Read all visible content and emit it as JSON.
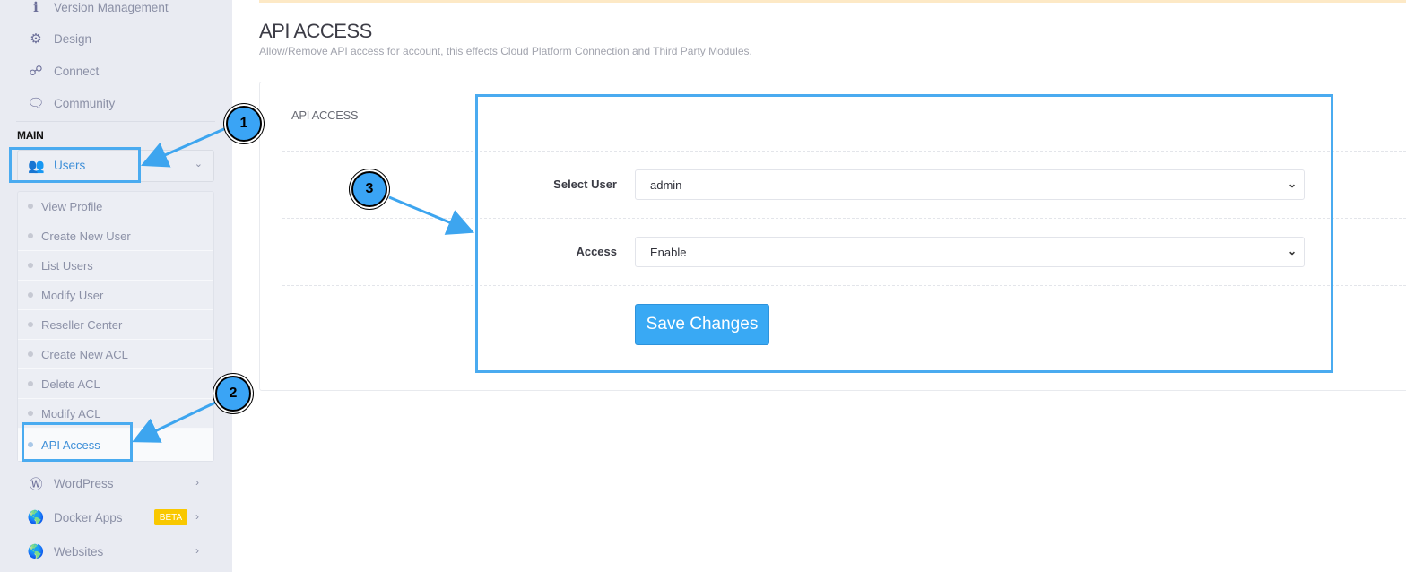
{
  "sidebar": {
    "top_items": [
      {
        "label": "Version Management",
        "icon": "info-icon"
      },
      {
        "label": "Design",
        "icon": "gear-icon"
      },
      {
        "label": "Connect",
        "icon": "link-icon"
      },
      {
        "label": "Community",
        "icon": "chat-icon"
      }
    ],
    "section_label": "MAIN",
    "users": {
      "label": "Users",
      "icon": "users-icon"
    },
    "users_submenu": [
      "View Profile",
      "Create New User",
      "List Users",
      "Modify User",
      "Reseller Center",
      "Create New ACL",
      "Delete ACL",
      "Modify ACL",
      "API Access"
    ],
    "bottom_items": [
      {
        "label": "WordPress",
        "icon": "wordpress-icon"
      },
      {
        "label": "Docker Apps",
        "icon": "globe-icon",
        "badge": "BETA"
      },
      {
        "label": "Websites",
        "icon": "globe-icon"
      }
    ]
  },
  "page": {
    "title": "API ACCESS",
    "subtitle": "Allow/Remove API access for account, this effects Cloud Platform Connection and Third Party Modules."
  },
  "panel": {
    "title": "API ACCESS",
    "select_user_label": "Select User",
    "select_user_value": "admin",
    "access_label": "Access",
    "access_value": "Enable",
    "save_label": "Save Changes"
  },
  "annotations": [
    "1",
    "2",
    "3"
  ],
  "colors": {
    "accent": "#39a9f4",
    "highlight": "#4aabf0",
    "beta": "#f9c800"
  }
}
